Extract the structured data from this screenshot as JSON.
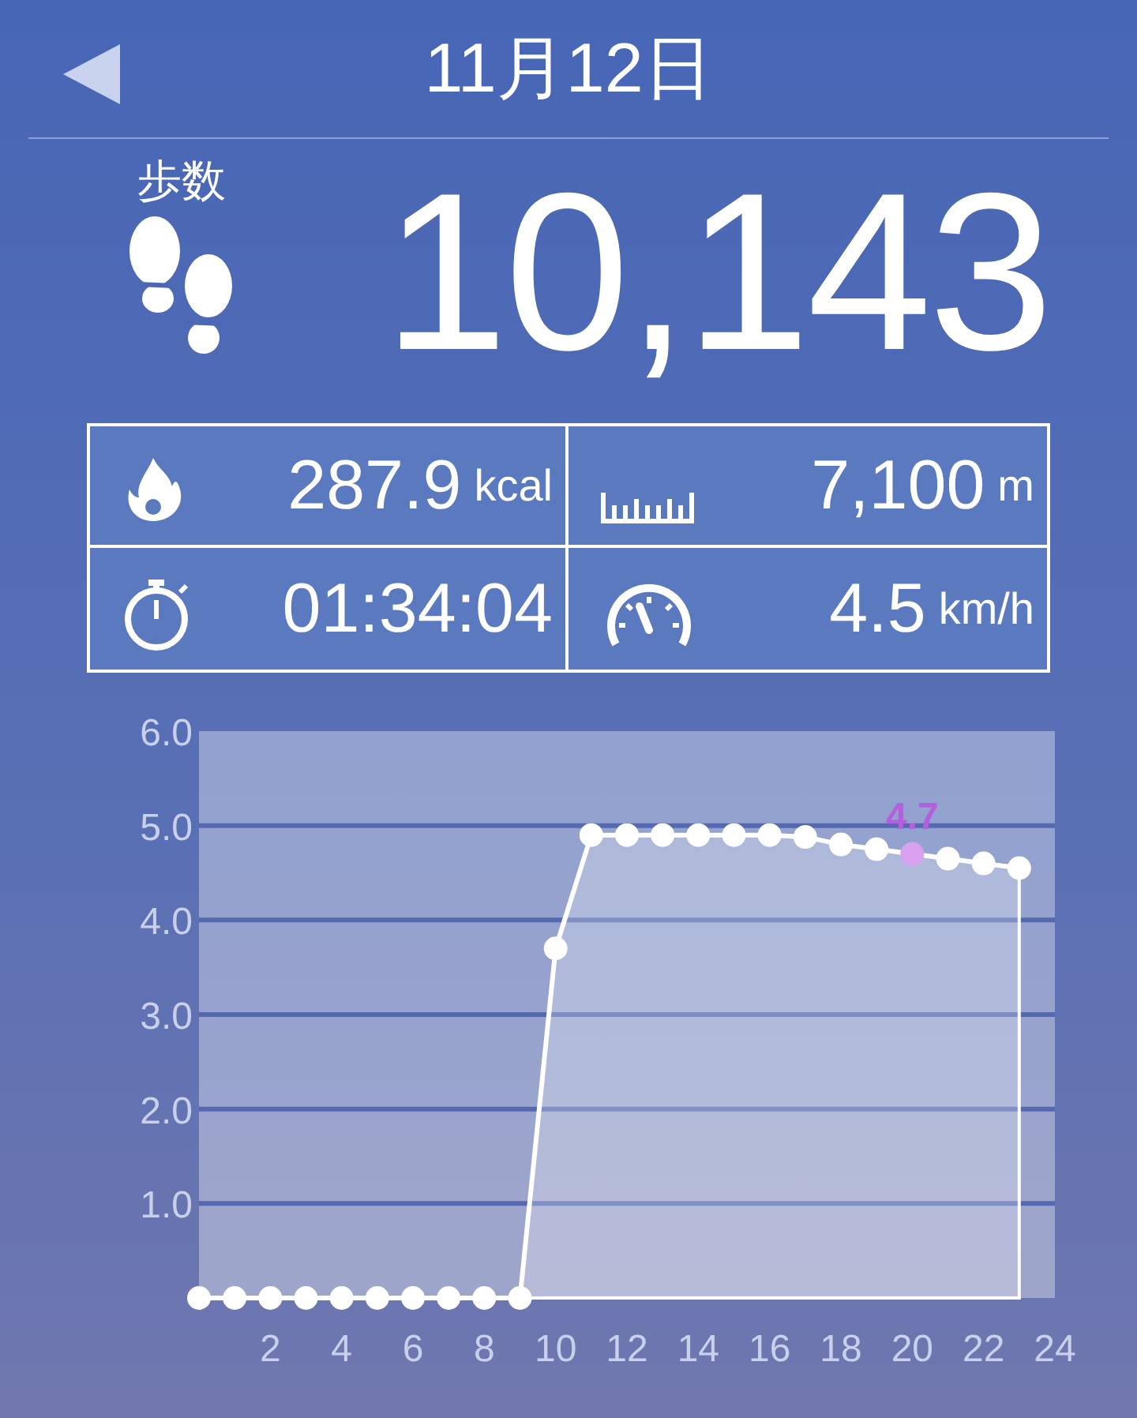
{
  "header": {
    "title": "11月12日"
  },
  "steps": {
    "label": "歩数",
    "value": "10,143"
  },
  "stats": [
    {
      "kind": "calories",
      "value": "287.9",
      "unit": "kcal"
    },
    {
      "kind": "distance",
      "value": "7,100",
      "unit": "m"
    },
    {
      "kind": "duration",
      "value": "01:34:04"
    },
    {
      "kind": "speed",
      "value": "4.5",
      "unit": "km/h"
    }
  ],
  "chart": {
    "chart_data": {
      "type": "area",
      "x": [
        0,
        1,
        2,
        3,
        4,
        5,
        6,
        7,
        8,
        9,
        10,
        11,
        12,
        13,
        14,
        15,
        16,
        17,
        18,
        19,
        20,
        21,
        22,
        23
      ],
      "values": [
        0,
        0,
        0,
        0,
        0,
        0,
        0,
        0,
        0,
        0,
        3.7,
        4.9,
        4.9,
        4.9,
        4.9,
        4.9,
        4.9,
        4.88,
        4.8,
        4.75,
        4.7,
        4.65,
        4.6,
        4.55
      ],
      "xlim": [
        0,
        24
      ],
      "ylim": [
        0,
        6
      ],
      "xticks": [
        2,
        4,
        6,
        8,
        10,
        12,
        14,
        16,
        18,
        20,
        22,
        24
      ],
      "yticks": [
        {
          "value": 1,
          "label": "1.0"
        },
        {
          "value": 2,
          "label": "2.0"
        },
        {
          "value": 3,
          "label": "3.0"
        },
        {
          "value": 4,
          "label": "4.0"
        },
        {
          "value": 5,
          "label": "5.0"
        },
        {
          "value": 6,
          "label": "6.0"
        }
      ],
      "grid": true,
      "annotations": [
        {
          "x": 20,
          "y": 4.7,
          "text": "4.7"
        }
      ]
    }
  }
}
